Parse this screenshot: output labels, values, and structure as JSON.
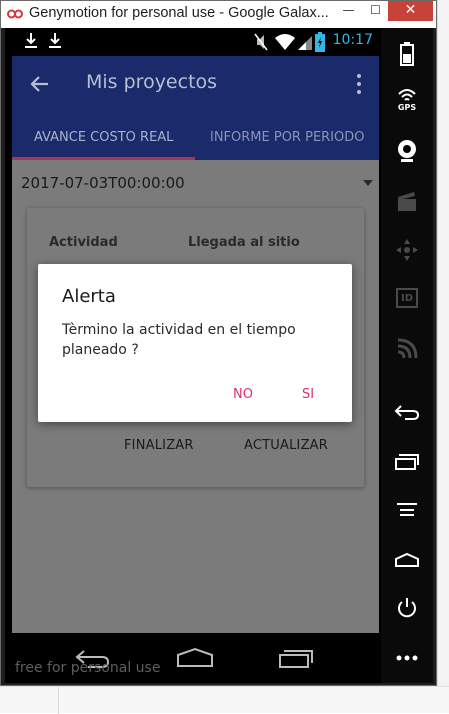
{
  "window": {
    "title": "Genymotion for personal use - Google Galax...",
    "min_glyph": "—",
    "max_glyph": "☐",
    "close_glyph": "✕"
  },
  "statusbar": {
    "time": "10:17",
    "time_color": "#33b5e5"
  },
  "appbar": {
    "title": "Mis proyectos",
    "color": "#1a2a6b"
  },
  "tabs": [
    {
      "label": "AVANCE COSTO REAL",
      "selected": true
    },
    {
      "label": "INFORME POR PERIODO",
      "selected": false
    }
  ],
  "date_select": {
    "value": "2017-07-03T00:00:00"
  },
  "card": {
    "col1": "Actividad",
    "col2": "Llegada al sitio",
    "finalizar_label": "FINALIZAR",
    "actualizar_label": "ACTUALIZAR"
  },
  "dialog": {
    "title": "Alerta",
    "message": "Tèrmino la actividad en el tiempo planeado ?",
    "no_label": "NO",
    "si_label": "SI",
    "accent": "#e0306a"
  },
  "watermark": "free for personal use",
  "sidebar": {
    "gps_label": "GPS",
    "id_label": "ID",
    "icons": [
      "battery-icon",
      "gps-icon",
      "webcam-icon",
      "clapper-icon",
      "dpad-icon",
      "id-icon",
      "cast-icon",
      "back-icon",
      "recent-apps-icon",
      "menu-icon",
      "home-icon",
      "power-icon",
      "more-icon"
    ]
  }
}
